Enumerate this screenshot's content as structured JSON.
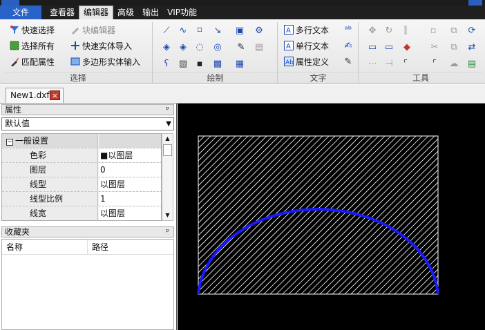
{
  "menubar": {
    "items": [
      "文件",
      "查看器",
      "编辑器",
      "高级",
      "输出",
      "VIP功能"
    ],
    "active": "编辑器"
  },
  "ribbon": {
    "select_group": {
      "label": "选择",
      "buttons": [
        "快速选择",
        "块编辑器",
        "选择所有",
        "快速实体导入",
        "匹配属性",
        "多边形实体输入"
      ]
    },
    "draw_group": {
      "label": "绘制"
    },
    "text_group": {
      "label": "文字",
      "buttons": [
        "多行文本",
        "单行文本",
        "属性定义"
      ]
    },
    "tools_group": {
      "label": "工具"
    }
  },
  "document_tab": {
    "name": "New1.dxf",
    "close_symbol": "×"
  },
  "properties": {
    "title": "属性",
    "pin_symbol": "ᵖ",
    "selector_value": "默认值",
    "category": "一般设置",
    "rows": [
      {
        "name": "色彩",
        "value": "■以图层"
      },
      {
        "name": "图层",
        "value": "0"
      },
      {
        "name": "线型",
        "value": "以图层"
      },
      {
        "name": "线型比例",
        "value": "1"
      },
      {
        "name": "线宽",
        "value": "以图层"
      }
    ]
  },
  "favorites": {
    "title": "收藏夹",
    "columns": [
      "名称",
      "路径"
    ]
  },
  "colors": {
    "canvas_bg": "#000000",
    "hatch": "#ffffff",
    "arc": "#1a1aff",
    "menubar_bg": "#1f1f1f",
    "file_tab": "#2a63c8"
  }
}
